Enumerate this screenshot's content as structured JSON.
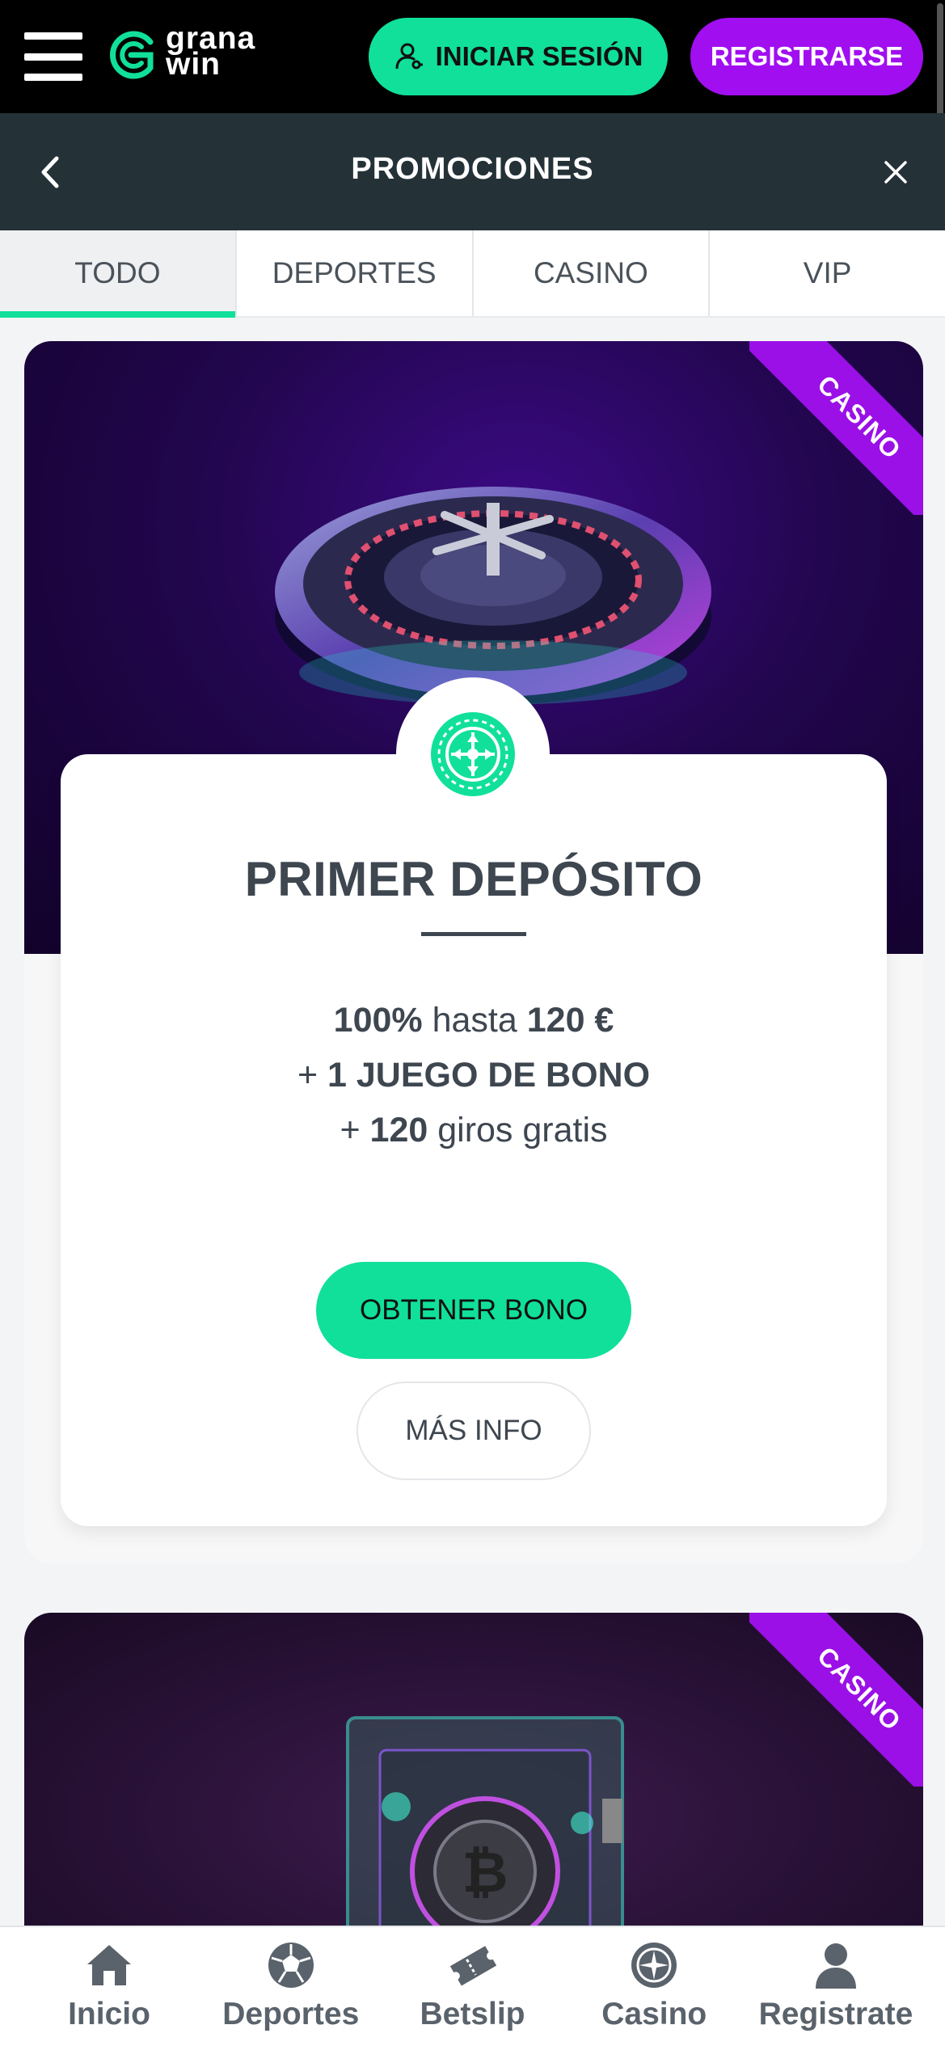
{
  "header": {
    "logo_line1": "grana",
    "logo_line2": "win",
    "login_label": "INICIAR SESIÓN",
    "register_label": "REGISTRARSE"
  },
  "subheader": {
    "title": "PROMOCIONES"
  },
  "tabs": [
    {
      "label": "TODO",
      "active": true
    },
    {
      "label": "DEPORTES",
      "active": false
    },
    {
      "label": "CASINO",
      "active": false
    },
    {
      "label": "VIP",
      "active": false
    }
  ],
  "promos": [
    {
      "ribbon": "CASINO",
      "title": "PRIMER DEPÓSITO",
      "line1_bold": "100%",
      "line1_rest": " hasta ",
      "line1_amount": "120 €",
      "line2_prefix": "+ ",
      "line2_bold": "1 JUEGO DE BONO",
      "line3_prefix": "+ ",
      "line3_bold": "120",
      "line3_rest": " giros gratis",
      "primary_button": "OBTENER BONO",
      "secondary_button": "MÁS INFO"
    },
    {
      "ribbon": "CASINO"
    }
  ],
  "bottom_nav": [
    {
      "label": "Inicio",
      "icon": "home-icon"
    },
    {
      "label": "Deportes",
      "icon": "soccer-ball-icon"
    },
    {
      "label": "Betslip",
      "icon": "ticket-icon"
    },
    {
      "label": "Casino",
      "icon": "roulette-icon"
    },
    {
      "label": "Registrate",
      "icon": "user-icon"
    }
  ],
  "colors": {
    "brand_green": "#10e09a",
    "brand_purple": "#a10ef0",
    "header_bg": "#000000",
    "subheader_bg": "#243238"
  }
}
